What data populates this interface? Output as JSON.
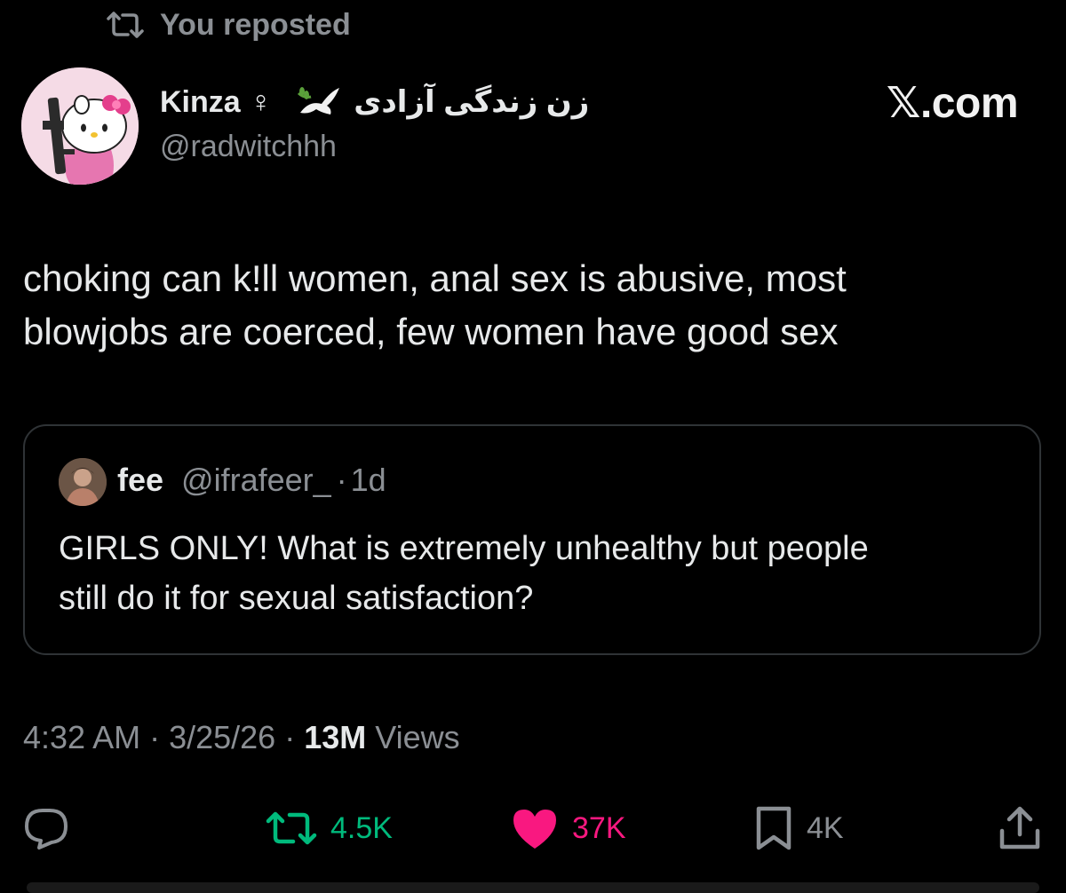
{
  "repost_banner": {
    "label": "You reposted",
    "icon": "repost-icon"
  },
  "author": {
    "name": "Kinza",
    "gender_symbol": "♀",
    "dove_icon": "dove-icon",
    "farsi_text": "زن زندگی آزادی",
    "handle": "@radwitchhh"
  },
  "watermark": {
    "label": "𝕏.com"
  },
  "tweet": {
    "lines": [
      "choking can k!ll women, anal sex is abusive, most",
      "blowjobs are coerced, few women have good sex"
    ]
  },
  "quote": {
    "name": "fee",
    "handle": "@ifrafeer_",
    "separator": "·",
    "age": "1d",
    "lines": [
      "GIRLS ONLY! What is extremely unhealthy but people",
      "still do it for sexual satisfaction?"
    ]
  },
  "meta": {
    "time": "4:32 AM",
    "sep1": " · ",
    "date": "3/25/26",
    "sep2": " · ",
    "views_count": "13M",
    "views_label": " Views"
  },
  "actions": {
    "reply": {
      "icon": "reply-icon",
      "count": ""
    },
    "repost": {
      "icon": "repost-icon",
      "count": "4.5K",
      "color": "#00ba7c"
    },
    "like": {
      "icon": "heart-icon",
      "count": "37K",
      "color": "#f91880"
    },
    "bookmark": {
      "icon": "bookmark-icon",
      "count": "4K"
    },
    "share": {
      "icon": "share-icon"
    }
  },
  "colors": {
    "background": "#000000",
    "text_primary": "#e7e9ea",
    "text_secondary": "#8b8f94",
    "border": "#2f3336"
  }
}
